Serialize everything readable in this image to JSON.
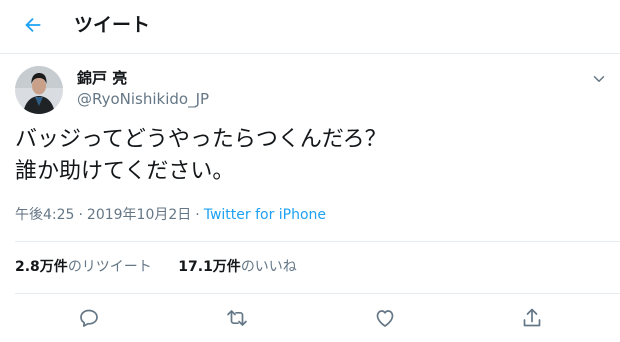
{
  "header": {
    "title": "ツイート"
  },
  "user": {
    "name": "錦戸 亮",
    "handle": "@RyoNishikido_JP"
  },
  "tweet": {
    "text": "バッジってどうやったらつくんだろ？\n誰か助けてください。"
  },
  "meta": {
    "time": "午後4:25",
    "date": "2019年10月2日",
    "source": "Twitter for iPhone"
  },
  "stats": {
    "retweets_count": "2.8万件",
    "retweets_label": "のリツイート",
    "likes_count": "17.1万件",
    "likes_label": "のいいね"
  },
  "colors": {
    "accent": "#1da1f2",
    "secondary_text": "#657786",
    "divider": "#e6ecf0"
  },
  "icons": [
    "back-arrow-icon",
    "chevron-down-icon",
    "reply-icon",
    "retweet-icon",
    "like-icon",
    "share-icon"
  ]
}
